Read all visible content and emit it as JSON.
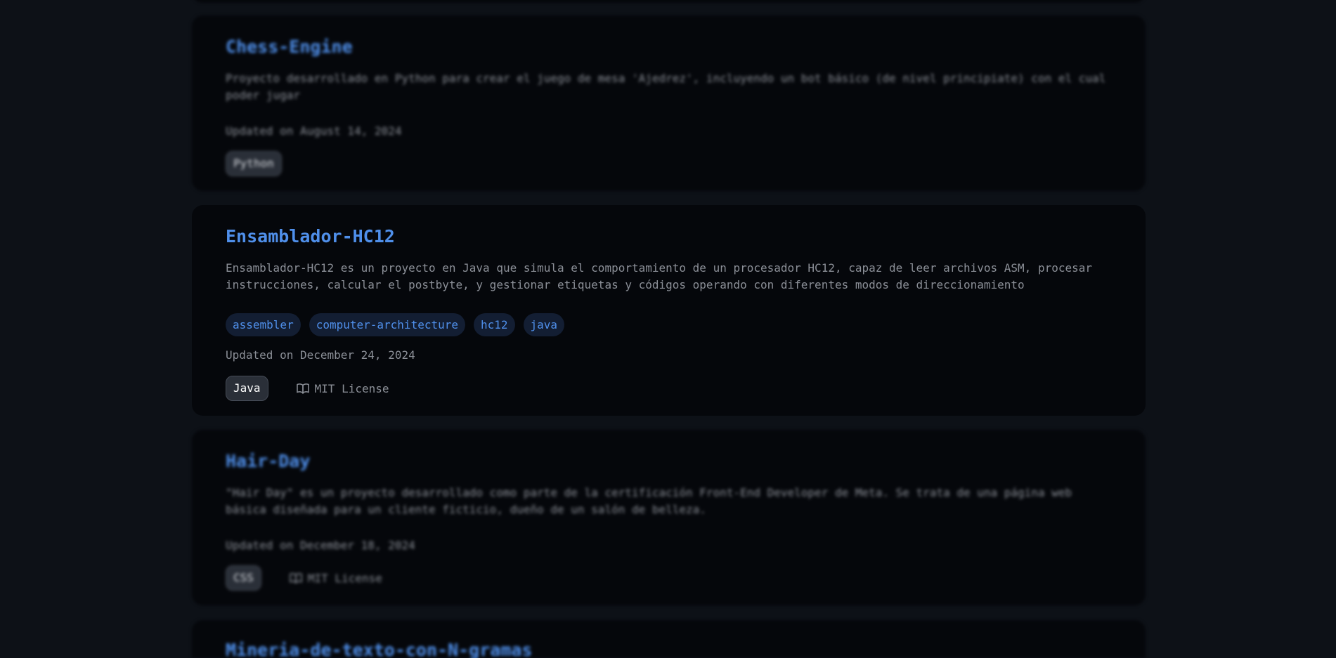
{
  "repos": [
    {
      "title": "Chess-Engine",
      "description": "Proyecto desarrollado en Python para crear el juego de mesa 'Ajedrez', incluyendo un bot básico (de nivel principiate) con el cual poder jugar",
      "updated": "Updated on August 14, 2024",
      "language": "Python"
    },
    {
      "title": "Ensamblador-HC12",
      "description": "Ensamblador-HC12 es un proyecto en Java que simula el comportamiento de un procesador HC12, capaz de leer archivos ASM, procesar instrucciones, calcular el postbyte, y gestionar etiquetas y códigos operando con diferentes modos de direccionamiento",
      "topics": [
        "assembler",
        "computer-architecture",
        "hc12",
        "java"
      ],
      "updated": "Updated on December 24, 2024",
      "language": "Java",
      "license": "MIT License"
    },
    {
      "title": "Hair-Day",
      "description": "\"Hair Day\" es un proyecto desarrollado como parte de la certificación Front-End Developer de Meta. Se trata de una página web básica diseñada para un cliente ficticio, dueño de un salón de belleza.",
      "updated": "Updated on December 18, 2024",
      "language": "CSS",
      "license": "MIT License"
    },
    {
      "title": "Mineria-de-texto-con-N-gramas"
    }
  ],
  "icons": {
    "license": "book-icon"
  },
  "colors": {
    "background": "#0d1117",
    "card": "#05070b",
    "link": "#4f8fea",
    "muted_text": "#8b8f97",
    "topic_bg": "#131e33"
  }
}
